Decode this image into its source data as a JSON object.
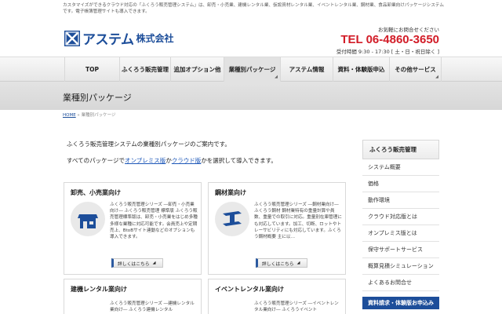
{
  "header": {
    "note": "カスタマイズができるクラウド対応の「ふくろう販売管理システム」は、卸売・小売業、建機レンタル業、仮設資材レンタル業、イベントレンタル業、鋼材業、食品卸業向けパッケージシステムです。電子帳簿管理サイトも導入できます。",
    "logo_text": "アステム",
    "logo_sub": "株式会社",
    "contact_lead": "お気軽にお問合せください",
    "tel": "TEL 06-4860-3650",
    "hours": "受付時間 9:30 - 17:30 [ 土・日・祝日除く ]"
  },
  "nav": {
    "items": [
      {
        "label": "TOP"
      },
      {
        "label": "ふくろう販売管理"
      },
      {
        "label": "追加オプション他"
      },
      {
        "label": "業種別パッケージ"
      },
      {
        "label": "アステム情報"
      },
      {
        "label": "資料・体験版申込"
      },
      {
        "label": "その他サービス"
      }
    ],
    "active_index": 3
  },
  "page": {
    "title": "業種別パッケージ",
    "breadcrumb_home": "HOME",
    "breadcrumb_sep": " » ",
    "breadcrumb_current": "業種別パッケージ",
    "intro1": "ふくろう販売管理システムの業種別パッケージのご案内です。",
    "intro2_pre": "すべてのパッケージで",
    "intro2_link1": "オンプレミス版",
    "intro2_mid": "か",
    "intro2_link2": "クラウド版",
    "intro2_post": "かを選択して導入できます。"
  },
  "cards": [
    {
      "title": "卸売、小売業向け",
      "icon": "store-icon",
      "desc": "ふくろう販売管理シリーズ ―卸売・小売業向け― ふくろう販売管理 標準版 ふくろう販売管理標準版は、卸売・小売業をはじめ多種多様な業種に対応可能です。会員売上や定期売上、BtoBサイト連動などのオプションも導入できます。",
      "button": "詳しくはこちら"
    },
    {
      "title": "鋼材業向け",
      "icon": "steel-beam-icon",
      "desc": "ふくろう販売管理シリーズ ―鋼材業向け― ふくろう鋼材 鋼材業特有の重量計算や員数、重量での取引に対応。重量別在庫管理にも対応しています。加工、切断、ロットやトレーサビリティにも対応しています。ふくろう鋼材概要 主に以…",
      "button": "詳しくはこちら"
    },
    {
      "title": "建機レンタル業向け",
      "desc": "ふくろう販売管理シリーズ ―建機レンタル業向け― ふくろう建機レンタル"
    },
    {
      "title": "イベントレンタル業向け",
      "desc": "ふくろう販売管理シリーズ ―イベントレンタル業向け― ふくろうイベント"
    }
  ],
  "sidebar": {
    "heading": "ふくろう販売管理",
    "items": [
      {
        "label": "システム概要"
      },
      {
        "label": "価格"
      },
      {
        "label": "動作環境"
      },
      {
        "label": "クラウド対応版とは"
      },
      {
        "label": "オンプレミス版とは"
      },
      {
        "label": "保守サポートサービス"
      },
      {
        "label": "概算見積シミュレーション"
      },
      {
        "label": "よくあるお問合せ"
      }
    ],
    "banner": "資料請求・体験版お申込み"
  },
  "colors": {
    "brand": "#1d4e9a",
    "tel": "#d21c27",
    "link": "#1d57b8"
  }
}
